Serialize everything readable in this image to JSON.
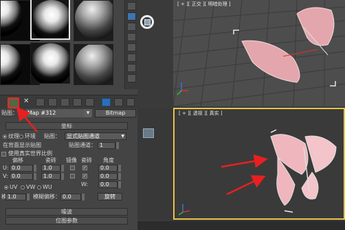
{
  "material_editor": {
    "slots": [
      {
        "name": "slot-1",
        "style": "env"
      },
      {
        "name": "slot-2",
        "style": "env"
      },
      {
        "name": "slot-3",
        "style": "plain"
      },
      {
        "name": "slot-4",
        "style": "env"
      },
      {
        "name": "slot-5",
        "style": "env"
      },
      {
        "name": "slot-6",
        "style": "plain"
      }
    ],
    "toolbar": {
      "highlighted_button": "assign-material-to-selection",
      "highlight_color": "#ff2020"
    },
    "name_row": {
      "label": "贴图：",
      "map_name": "Map #312",
      "type_button": "Bitmap"
    },
    "coordinates": {
      "title": "坐标",
      "texture_label": "纹理",
      "environ_label": "环境",
      "mapping_label": "贴图：",
      "mapping_value": "显式贴图通道",
      "show_map_back": "在背面显示贴图",
      "map_channel_label": "贴图通道：",
      "map_channel_value": "1",
      "real_world": "使用真实世界比例",
      "col_offset": "偏移",
      "col_tiling": "瓷砖",
      "col_mirror": "镜像",
      "col_tile": "瓷砖",
      "col_angle": "角度",
      "rows": [
        {
          "axis": "U:",
          "offset": "0.0",
          "tiling": "1.0",
          "angle": "0.0"
        },
        {
          "axis": "V:",
          "offset": "0.0",
          "tiling": "1.0",
          "angle": "0.0"
        },
        {
          "axis": "W:",
          "offset": "",
          "tiling": "",
          "angle": "0.0"
        }
      ],
      "uv": "UV",
      "vw": "VW",
      "wu": "WU",
      "blur_label": "模糊：",
      "blur_value": "1.0",
      "blur_offset_label": "模糊偏移：",
      "blur_offset_value": "0.0",
      "rotate_button": "旋转"
    },
    "noise_title": "噪波",
    "bitmap_params_title": "位图参数"
  },
  "viewports": {
    "top_label": "[ + ][ 正交 ][ 明暗处理 ]",
    "persp_label": "[ + ][ 透视 ][ 真实 ]",
    "active_color": "#e8c44a"
  },
  "annotations": {
    "arrow_color": "#e82020"
  }
}
